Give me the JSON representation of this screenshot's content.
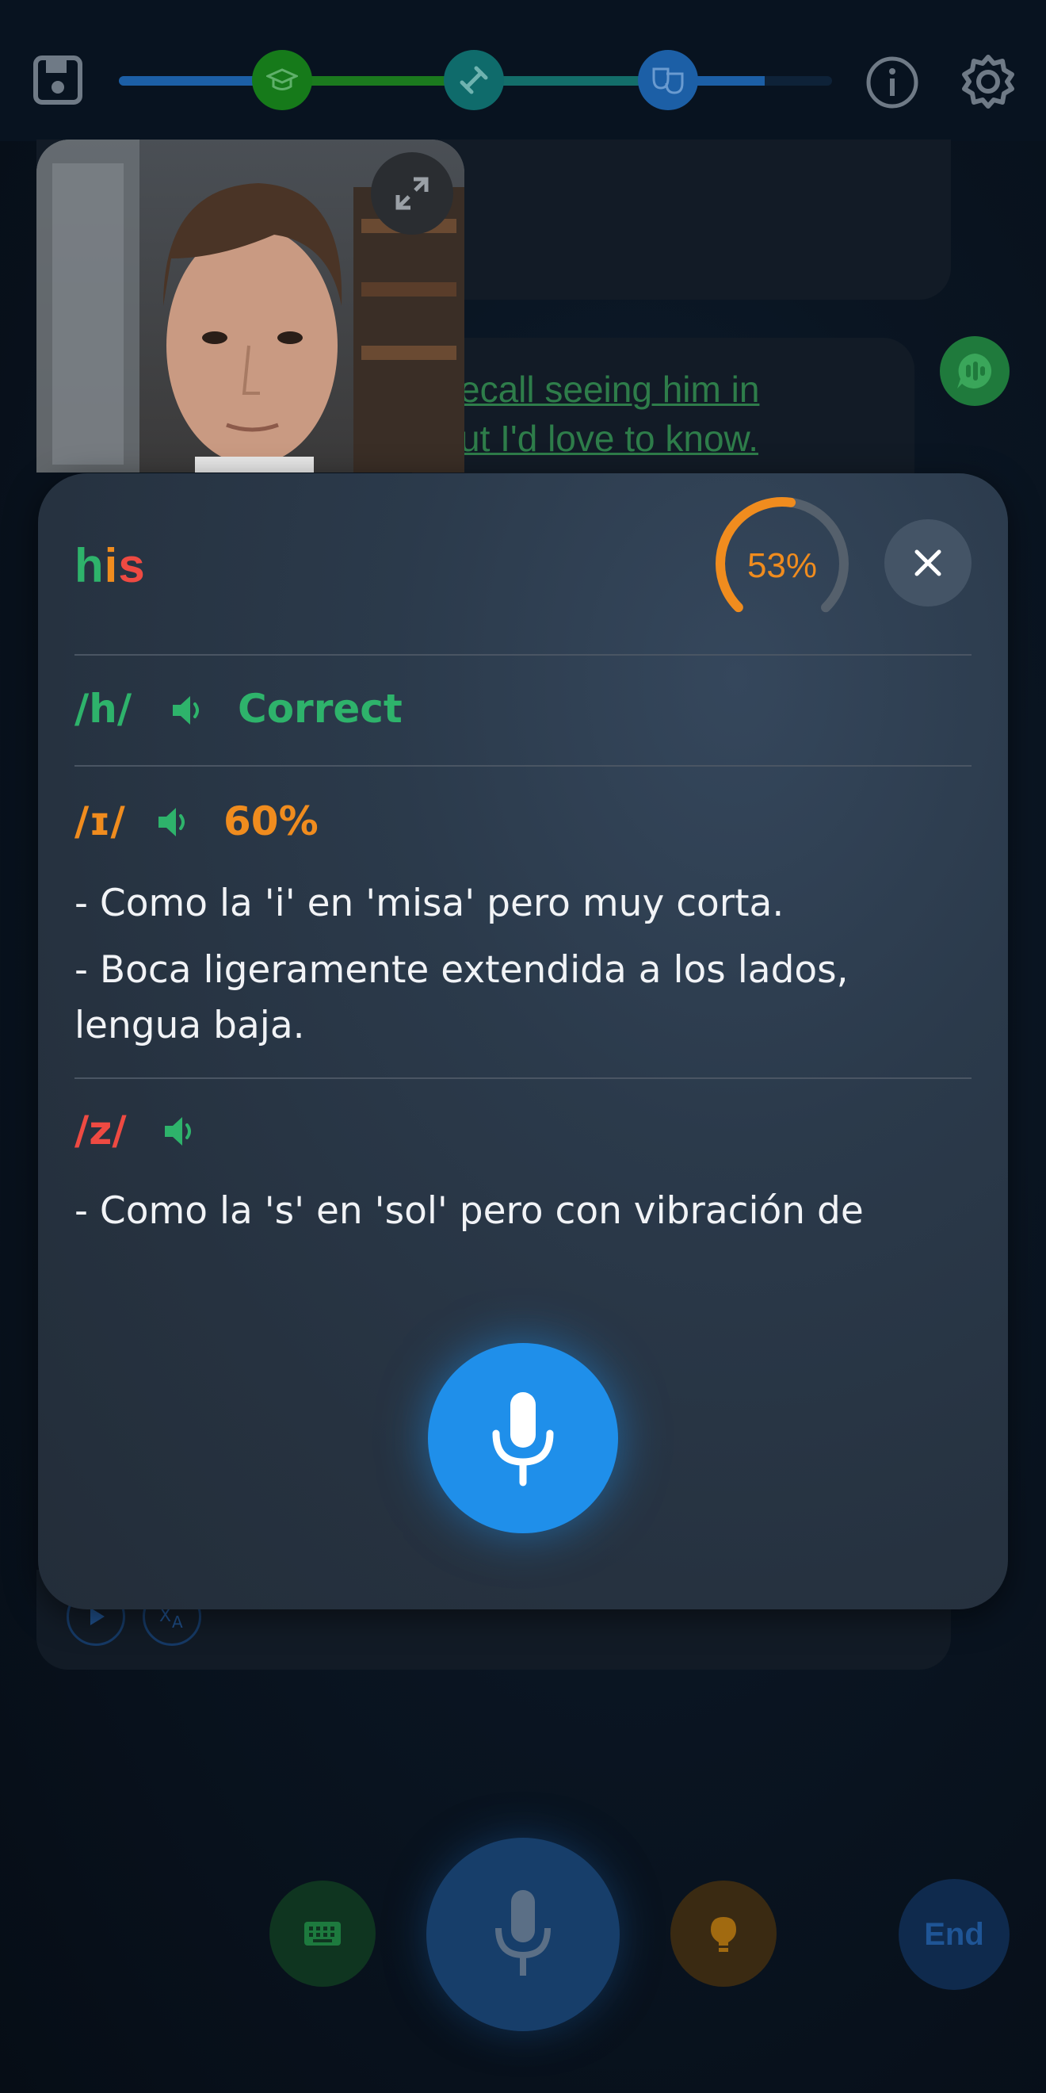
{
  "top_bar": {
    "save_icon": "save-icon",
    "milestones": [
      "graduation-cap-icon",
      "dumbbell-icon",
      "theater-masks-icon"
    ],
    "info_icon": "info-icon",
    "settings_icon": "gear-icon",
    "progress_fraction": 0.86
  },
  "conversation": {
    "bubble_lines": [
      "ecall seeing him in",
      "ut I'd love to know."
    ],
    "speak_icon": "chat-voice-icon",
    "message_actions": [
      "play-icon",
      "translate-icon"
    ]
  },
  "bottom_controls": {
    "keyboard_icon": "keyboard-icon",
    "mic_icon": "microphone-icon",
    "hint_icon": "lightbulb-icon",
    "end_label": "End"
  },
  "modal": {
    "word_parts": [
      {
        "text": "h",
        "color": "#2eb36b"
      },
      {
        "text": "i",
        "color": "#f08c1e"
      },
      {
        "text": "s",
        "color": "#ee4a42"
      }
    ],
    "score": "53%",
    "score_fraction": 0.53,
    "close_icon": "close-icon",
    "phonemes": [
      {
        "symbol": "/h/",
        "status": "Correct",
        "color": "#2eb36b",
        "tips": []
      },
      {
        "symbol": "/ɪ/",
        "status": "60%",
        "color": "#f08c1e",
        "tips": [
          "- Como la 'i' en 'misa' pero muy corta.",
          "- Boca ligeramente extendida a los lados, lengua baja."
        ]
      },
      {
        "symbol": "/z/",
        "status": "",
        "color": "#ee4a42",
        "tips": [
          "- Como la 's' en 'sol' pero con vibración de cuerdas vocales."
        ]
      }
    ],
    "mic_icon": "microphone-icon"
  },
  "colors": {
    "correct": "#2eb36b",
    "partial": "#f08c1e",
    "wrong": "#ee4a42",
    "accent_blue": "#1f8fea"
  }
}
